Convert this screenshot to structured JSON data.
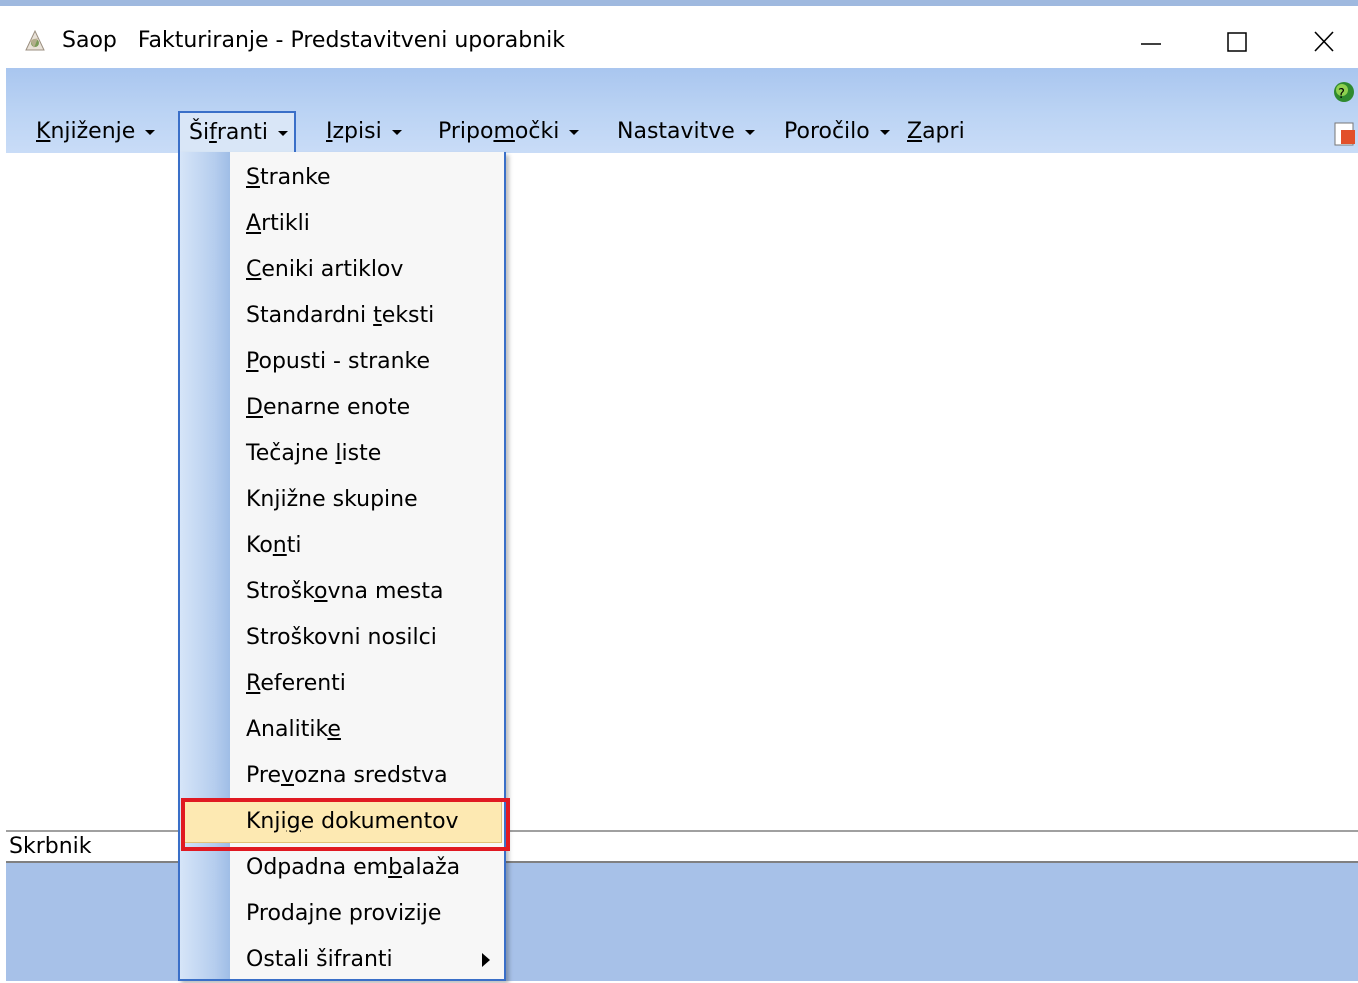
{
  "window": {
    "title": "Saop   Fakturiranje - Predstavitveni uporabnik",
    "icon": "app-icon"
  },
  "menubar": {
    "items": [
      {
        "pre": "",
        "mn": "K",
        "post": "njiženje",
        "has_caret": true
      },
      {
        "pre": "Ši",
        "mn": "f",
        "post": "ranti",
        "has_caret": true
      },
      {
        "pre": "",
        "mn": "I",
        "post": "zpisi",
        "has_caret": true
      },
      {
        "pre": "Pripo",
        "mn": "m",
        "post": "očki",
        "has_caret": true
      },
      {
        "pre": "Nastavitve",
        "mn": "",
        "post": "",
        "has_caret": true
      },
      {
        "pre": "Poročilo",
        "mn": "",
        "post": "",
        "has_caret": true
      },
      {
        "pre": "",
        "mn": "Z",
        "post": "apri",
        "has_caret": false
      }
    ]
  },
  "dropdown": {
    "highlighted_index": 14,
    "items": [
      {
        "pre": "",
        "mn": "S",
        "post": "tranke"
      },
      {
        "pre": "",
        "mn": "A",
        "post": "rtikli"
      },
      {
        "pre": "",
        "mn": "C",
        "post": "eniki artiklov"
      },
      {
        "pre": "Standardni ",
        "mn": "t",
        "post": "eksti"
      },
      {
        "pre": "",
        "mn": "P",
        "post": "opusti - stranke"
      },
      {
        "pre": "",
        "mn": "D",
        "post": "enarne enote"
      },
      {
        "pre": "Tečajne ",
        "mn": "l",
        "post": "iste"
      },
      {
        "pre": "Knjižne skupine",
        "mn": "",
        "post": ""
      },
      {
        "pre": "Ko",
        "mn": "n",
        "post": "ti"
      },
      {
        "pre": "Strošk",
        "mn": "o",
        "post": "vna mesta"
      },
      {
        "pre": "Stroškovni nosilci",
        "mn": "",
        "post": ""
      },
      {
        "pre": "",
        "mn": "R",
        "post": "eferenti"
      },
      {
        "pre": "Analitik",
        "mn": "e",
        "post": ""
      },
      {
        "pre": "Pre",
        "mn": "v",
        "post": "ozna sredstva"
      },
      {
        "pre": "Knji",
        "mn": "g",
        "post": "e dokumentov"
      },
      {
        "pre": "Odpadna em",
        "mn": "b",
        "post": "alaža"
      },
      {
        "pre": "Prodajne provizije",
        "mn": "",
        "post": ""
      },
      {
        "pre": "Ostali šifranti",
        "mn": "",
        "post": "",
        "submenu": true
      }
    ]
  },
  "statusbar": {
    "label": "Skrbnik"
  },
  "colors": {
    "menu_band": "#b8d0f2",
    "bottom_band": "#a7c1e8",
    "highlight": "#fde9b2",
    "annotation_red": "#e01922",
    "menu_border": "#3a6fc8"
  }
}
